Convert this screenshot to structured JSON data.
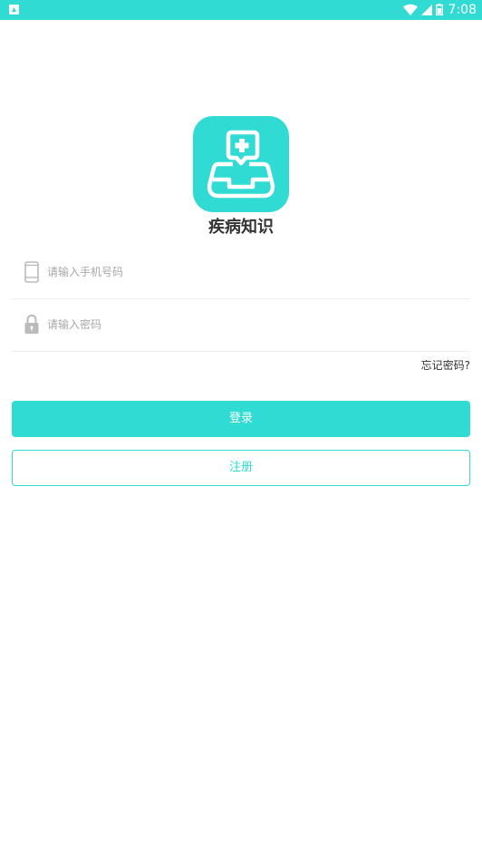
{
  "status_bar": {
    "time": "7:08",
    "icons": [
      "notification-icon",
      "wifi-icon",
      "signal-icon",
      "battery-icon"
    ]
  },
  "app": {
    "name": "疾病知识",
    "logo_icon": "medical-chat-icon"
  },
  "form": {
    "phone_placeholder": "请输入手机号码",
    "phone_value": "",
    "phone_icon": "phone-icon",
    "password_placeholder": "请输入密码",
    "password_value": "",
    "password_icon": "lock-icon",
    "forgot_label": "忘记密码?",
    "login_label": "登录",
    "register_label": "注册"
  },
  "colors": {
    "accent": "#30dbd3",
    "text": "#333333",
    "placeholder": "#a8a8a8",
    "divider": "#eeeeee"
  }
}
